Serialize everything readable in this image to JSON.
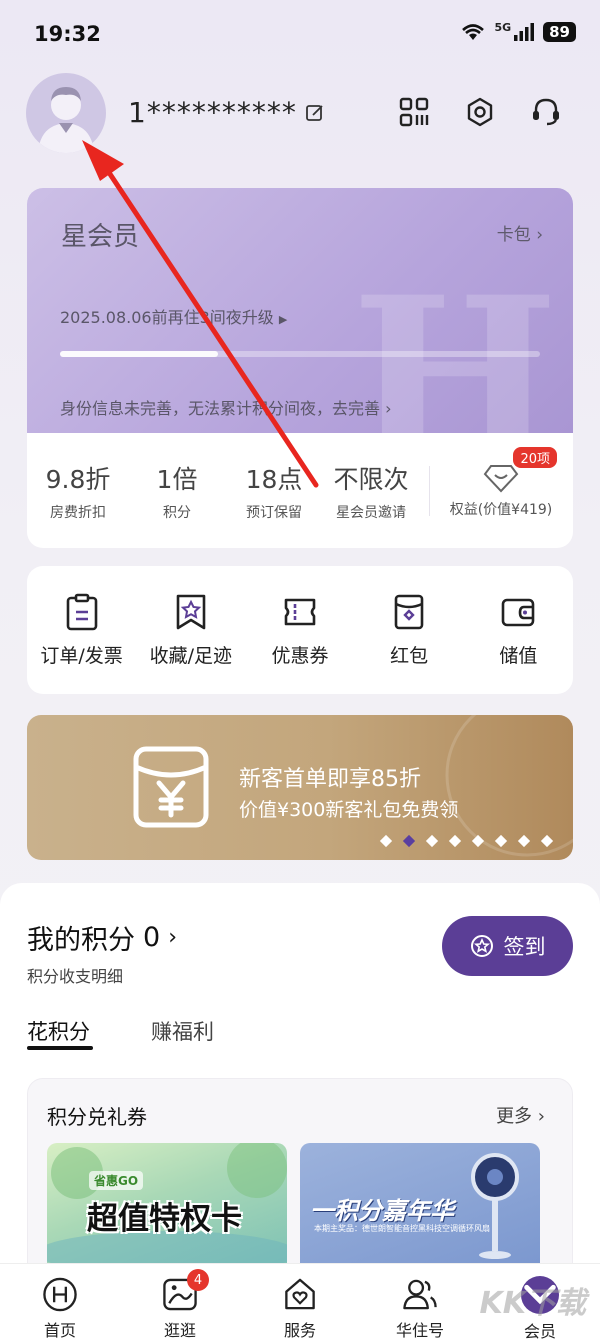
{
  "status_bar": {
    "time": "19:32",
    "network": "5G",
    "battery": "89"
  },
  "header": {
    "phone_masked": "1**********",
    "icons": [
      "avatar-icon",
      "edit-icon",
      "qr-code-icon",
      "settings-icon",
      "customer-service-icon"
    ]
  },
  "member_card": {
    "level": "星会员",
    "wallet_link": "卡包",
    "upgrade_tip": "2025.08.06前再住3间夜升级",
    "identity_tip": "身份信息未完善，无法累计积分间夜，去完善",
    "benefits": [
      {
        "value": "9.8折",
        "label": "房费折扣"
      },
      {
        "value": "1倍",
        "label": "积分"
      },
      {
        "value": "18点",
        "label": "预订保留"
      },
      {
        "value": "不限次",
        "label": "星会员邀请"
      }
    ],
    "rights": {
      "badge": "20项",
      "label": "权益(价值¥419)"
    }
  },
  "shortcuts": [
    {
      "label": "订单/发票",
      "icon": "order-icon"
    },
    {
      "label": "收藏/足迹",
      "icon": "favorite-icon"
    },
    {
      "label": "优惠券",
      "icon": "coupon-icon"
    },
    {
      "label": "红包",
      "icon": "red-packet-icon"
    },
    {
      "label": "储值",
      "icon": "wallet-icon"
    }
  ],
  "banner": {
    "title": "新客首单即享85折",
    "subtitle": "价值¥300新客礼包免费领",
    "slides": 8,
    "active_slide": 2
  },
  "points": {
    "title": "我的积分",
    "value": "0",
    "detail_link": "积分收支明细",
    "signin_label": "签到",
    "tabs": [
      "花积分",
      "赚福利"
    ],
    "active_tab": "花积分"
  },
  "exchange": {
    "title": "积分兑礼券",
    "more": "更多",
    "coupons": [
      {
        "tag": "省惠GO",
        "text": "超值特权卡"
      },
      {
        "text": "一积分嘉年华",
        "sub": "本期主奖品：德世朗智能音控黑科技空调循环风扇"
      }
    ]
  },
  "bottom_nav": [
    {
      "label": "首页",
      "icon": "home-h-icon"
    },
    {
      "label": "逛逛",
      "icon": "browse-icon",
      "badge": "4"
    },
    {
      "label": "服务",
      "icon": "service-icon"
    },
    {
      "label": "华住号",
      "icon": "people-icon"
    },
    {
      "label": "会员",
      "icon": "member-icon",
      "active": true
    }
  ],
  "watermark": "KK下载",
  "colors": {
    "accent": "#5b3e96",
    "card": "#b6a4dc",
    "banner": "#c3a67c",
    "badge": "#e5352c",
    "arrow": "#e8261f"
  }
}
